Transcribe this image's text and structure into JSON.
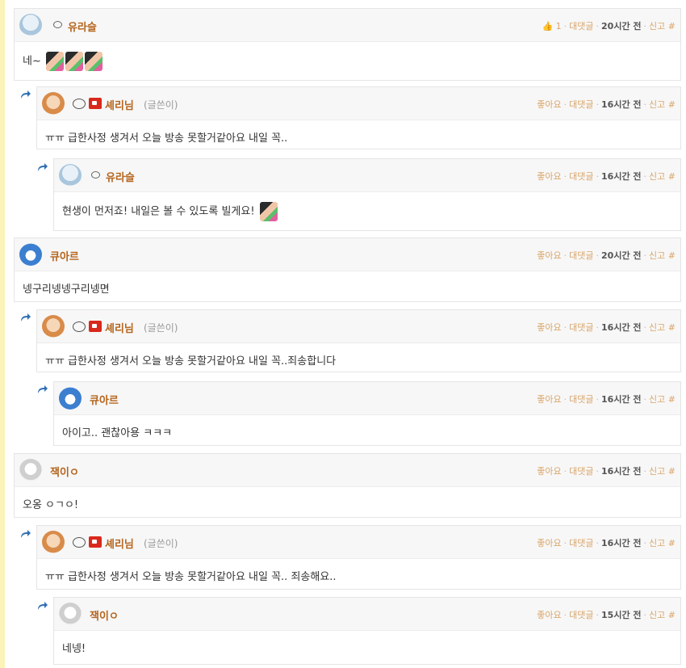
{
  "comments": [
    {
      "nick": "유라슬",
      "author_tag": "",
      "like": "1",
      "reply": "대댓글",
      "time": "20시간 전",
      "report": "신고",
      "hash": "#",
      "body": "네~"
    },
    {
      "nick": "셰리님",
      "author_tag": "(글쓴이)",
      "like": "좋아요",
      "reply": "대댓글",
      "time": "16시간 전",
      "report": "신고",
      "hash": "#",
      "body": "ㅠㅠ 급한사정 생겨서 오늘 방송 못할거같아요 내일 꼭.."
    },
    {
      "nick": "유라슬",
      "author_tag": "",
      "like": "좋아요",
      "reply": "대댓글",
      "time": "16시간 전",
      "report": "신고",
      "hash": "#",
      "body": "현생이 먼저죠! 내일은 볼 수 있도록 빌게요!"
    },
    {
      "nick": "큐아르",
      "author_tag": "",
      "like": "좋아요",
      "reply": "대댓글",
      "time": "20시간 전",
      "report": "신고",
      "hash": "#",
      "body": "넹구리넹넹구리넹면"
    },
    {
      "nick": "셰리님",
      "author_tag": "(글쓴이)",
      "like": "좋아요",
      "reply": "대댓글",
      "time": "16시간 전",
      "report": "신고",
      "hash": "#",
      "body": "ㅠㅠ 급한사정 생겨서 오늘 방송 못할거같아요 내일 꼭..죄송합니다"
    },
    {
      "nick": "큐아르",
      "author_tag": "",
      "like": "좋아요",
      "reply": "대댓글",
      "time": "16시간 전",
      "report": "신고",
      "hash": "#",
      "body": "아이고.. 괜찮아용 ㅋㅋㅋ"
    },
    {
      "nick": "잭이ㅇ",
      "author_tag": "",
      "like": "좋아요",
      "reply": "대댓글",
      "time": "16시간 전",
      "report": "신고",
      "hash": "#",
      "body": "오옹 ㅇㄱㅇ!"
    },
    {
      "nick": "셰리님",
      "author_tag": "(글쓴이)",
      "like": "좋아요",
      "reply": "대댓글",
      "time": "16시간 전",
      "report": "신고",
      "hash": "#",
      "body": "ㅠㅠ 급한사정 생겨서 오늘 방송 못할거같아요 내일 꼭.. 죄송해요.."
    },
    {
      "nick": "잭이ㅇ",
      "author_tag": "",
      "like": "좋아요",
      "reply": "대댓글",
      "time": "15시간 전",
      "report": "신고",
      "hash": "#",
      "body": "네넹!"
    }
  ],
  "colors": {
    "nick": "#b5651d",
    "meta": "#d9a56a",
    "reply_icon": "#2f6fb3",
    "cam": "#d9291c"
  }
}
